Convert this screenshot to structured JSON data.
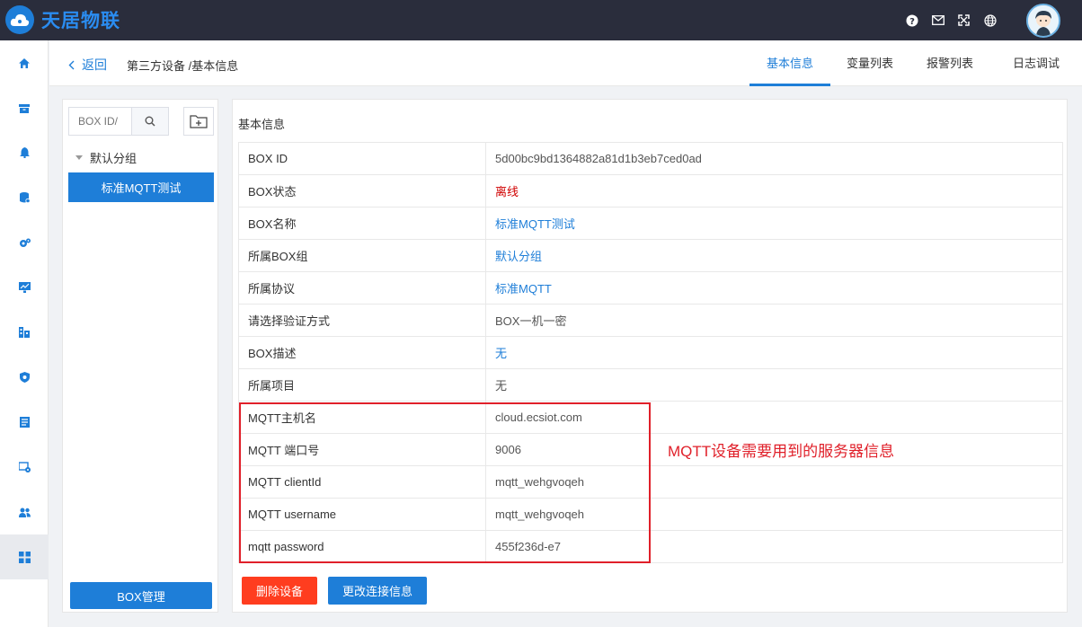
{
  "app": {
    "name": "天居物联"
  },
  "header": {
    "back_label": "返回",
    "breadcrumb": "第三方设备 /基本信息",
    "tabs": [
      {
        "label": "基本信息",
        "active": true
      },
      {
        "label": "变量列表",
        "active": false
      },
      {
        "label": "报警列表",
        "active": false
      },
      {
        "label": "日志调试",
        "active": false
      }
    ]
  },
  "sidebar": {
    "items": [
      {
        "icon": "home-icon"
      },
      {
        "icon": "box-icon"
      },
      {
        "icon": "bell-icon"
      },
      {
        "icon": "database-icon"
      },
      {
        "icon": "gears-icon"
      },
      {
        "icon": "monitor-icon"
      },
      {
        "icon": "building-icon"
      },
      {
        "icon": "shield-icon"
      },
      {
        "icon": "list-icon"
      },
      {
        "icon": "device-settings-icon"
      },
      {
        "icon": "users-icon"
      },
      {
        "icon": "grid-icon",
        "active": true
      }
    ]
  },
  "group_panel": {
    "search_placeholder": "BOX ID/",
    "group_name": "默认分组",
    "selected_device": "标准MQTT测试",
    "manage_button": "BOX管理"
  },
  "info": {
    "title": "基本信息",
    "rows": [
      {
        "key": "BOX ID",
        "value": "5d00bc9bd1364882a81d1b3eb7ced0ad",
        "style": "normal"
      },
      {
        "key": "BOX状态",
        "value": "离线",
        "style": "red"
      },
      {
        "key": "BOX名称",
        "value": "标准MQTT测试",
        "style": "link"
      },
      {
        "key": "所属BOX组",
        "value": "默认分组",
        "style": "link"
      },
      {
        "key": "所属协议",
        "value": "标准MQTT",
        "style": "link"
      },
      {
        "key": "请选择验证方式",
        "value": "BOX一机一密",
        "style": "normal"
      },
      {
        "key": "BOX描述",
        "value": "无",
        "style": "link"
      },
      {
        "key": "所属项目",
        "value": "无",
        "style": "normal"
      },
      {
        "key": "MQTT主机名",
        "value": "cloud.ecsiot.com",
        "style": "normal"
      },
      {
        "key": "MQTT 端口号",
        "value": "9006",
        "style": "normal"
      },
      {
        "key": "MQTT clientId",
        "value": "mqtt_wehgvoqeh",
        "style": "normal"
      },
      {
        "key": "MQTT username",
        "value": "mqtt_wehgvoqeh",
        "style": "normal"
      },
      {
        "key": "mqtt password",
        "value": "455f236d-e7",
        "style": "normal"
      }
    ],
    "annotation": "MQTT设备需要用到的服务器信息",
    "delete_button": "删除设备",
    "edit_button": "更改连接信息"
  },
  "colors": {
    "accent": "#1e7ed8",
    "topbar": "#2a2d3c",
    "danger": "#ff3d1f",
    "annotation": "#e0202a"
  }
}
